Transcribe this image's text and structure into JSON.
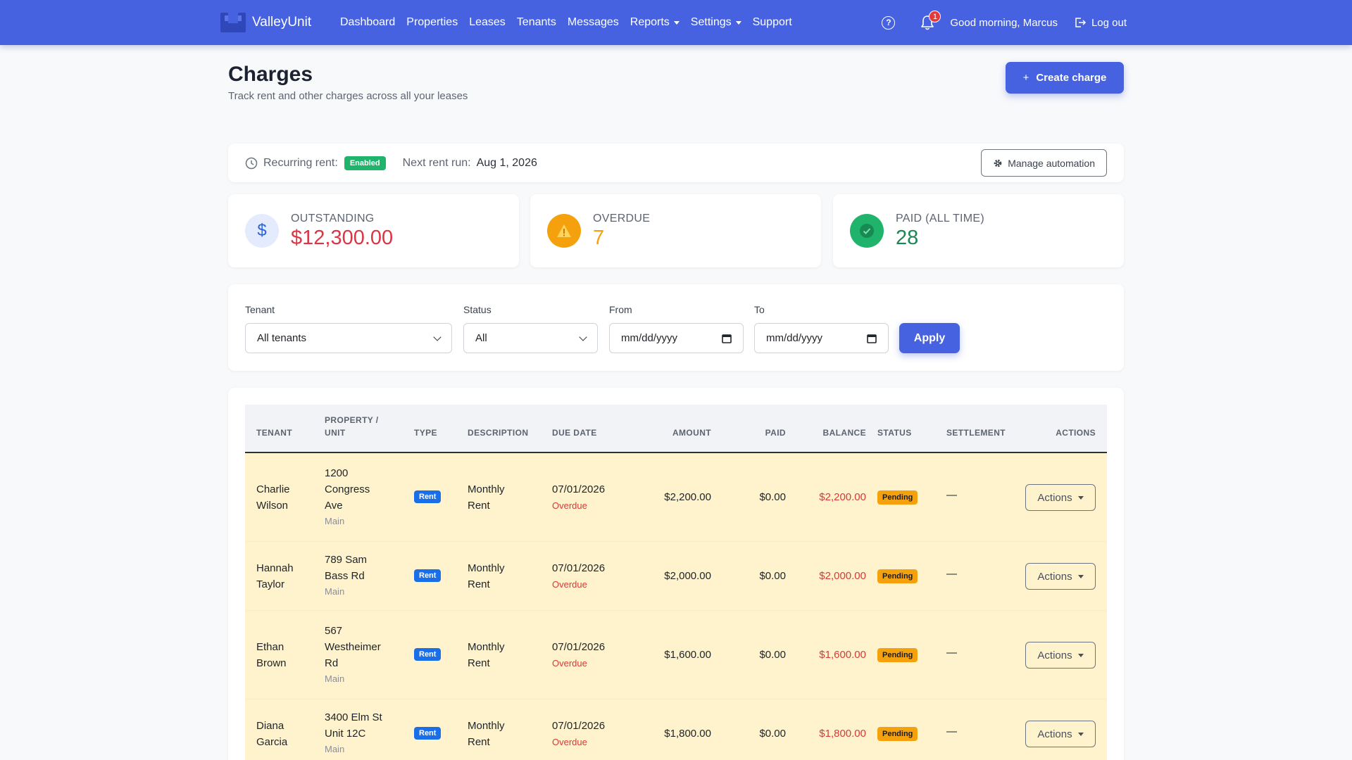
{
  "nav": {
    "brand": "ValleyUnit",
    "links": [
      "Dashboard",
      "Properties",
      "Leases",
      "Tenants",
      "Messages"
    ],
    "dropdowns": [
      "Reports",
      "Settings"
    ],
    "support": "Support",
    "notifications": "1",
    "greeting": "Good morning, Marcus",
    "logout": "Log out"
  },
  "header": {
    "title": "Charges",
    "subtitle": "Track rent and other charges across all your leases",
    "create_button": "Create charge"
  },
  "recurring": {
    "label": "Recurring rent:",
    "status": "Enabled",
    "next_run_label": "Next rent run:",
    "next_run_value": "Aug 1, 2026",
    "manage_button": "Manage automation"
  },
  "stats": {
    "outstanding": {
      "label": "OUTSTANDING",
      "value": "$12,300.00",
      "color": "#dc3545"
    },
    "overdue": {
      "label": "OVERDUE",
      "value": "7",
      "color": "#f5a10d"
    },
    "paid": {
      "label": "PAID (ALL TIME)",
      "value": "28",
      "color": "#198754"
    }
  },
  "filters": {
    "tenant_label": "Tenant",
    "tenant_value": "All tenants",
    "status_label": "Status",
    "status_value": "All",
    "from_label": "From",
    "from_placeholder": "mm/dd/yyyy",
    "to_label": "To",
    "to_placeholder": "mm/dd/yyyy",
    "apply": "Apply"
  },
  "table": {
    "headers": {
      "tenant": "TENANT",
      "property_line1": "PROPERTY /",
      "property_line2": "UNIT",
      "type": "TYPE",
      "description": "DESCRIPTION",
      "due_date": "DUE DATE",
      "amount": "AMOUNT",
      "paid": "PAID",
      "balance": "BALANCE",
      "status": "STATUS",
      "settlement": "SETTLEMENT",
      "actions": "ACTIONS"
    },
    "rows": [
      {
        "tenant": [
          "Charlie",
          "Wilson"
        ],
        "property": [
          "1200",
          "Congress",
          "Ave"
        ],
        "unit": "Main",
        "type": "Rent",
        "description": [
          "Monthly",
          "Rent"
        ],
        "due": "07/01/2026",
        "due_note": "Overdue",
        "amount": "$2,200.00",
        "paid": "$0.00",
        "balance": "$2,200.00",
        "status": "Pending",
        "settlement": "—",
        "actions": "Actions"
      },
      {
        "tenant": [
          "Hannah",
          "Taylor"
        ],
        "property": [
          "789 Sam",
          "Bass Rd"
        ],
        "unit": "Main",
        "type": "Rent",
        "description": [
          "Monthly",
          "Rent"
        ],
        "due": "07/01/2026",
        "due_note": "Overdue",
        "amount": "$2,000.00",
        "paid": "$0.00",
        "balance": "$2,000.00",
        "status": "Pending",
        "settlement": "—",
        "actions": "Actions"
      },
      {
        "tenant": [
          "Ethan",
          "Brown"
        ],
        "property": [
          "567",
          "Westheimer",
          "Rd"
        ],
        "unit": "Main",
        "type": "Rent",
        "description": [
          "Monthly",
          "Rent"
        ],
        "due": "07/01/2026",
        "due_note": "Overdue",
        "amount": "$1,600.00",
        "paid": "$0.00",
        "balance": "$1,600.00",
        "status": "Pending",
        "settlement": "—",
        "actions": "Actions"
      },
      {
        "tenant": [
          "Diana",
          "Garcia"
        ],
        "property": [
          "3400 Elm St",
          "Unit 12C"
        ],
        "unit": "Main",
        "type": "Rent",
        "description": [
          "Monthly",
          "Rent"
        ],
        "due": "07/01/2026",
        "due_note": "Overdue",
        "amount": "$1,800.00",
        "paid": "$0.00",
        "balance": "$1,800.00",
        "status": "Pending",
        "settlement": "—",
        "actions": "Actions"
      }
    ]
  }
}
